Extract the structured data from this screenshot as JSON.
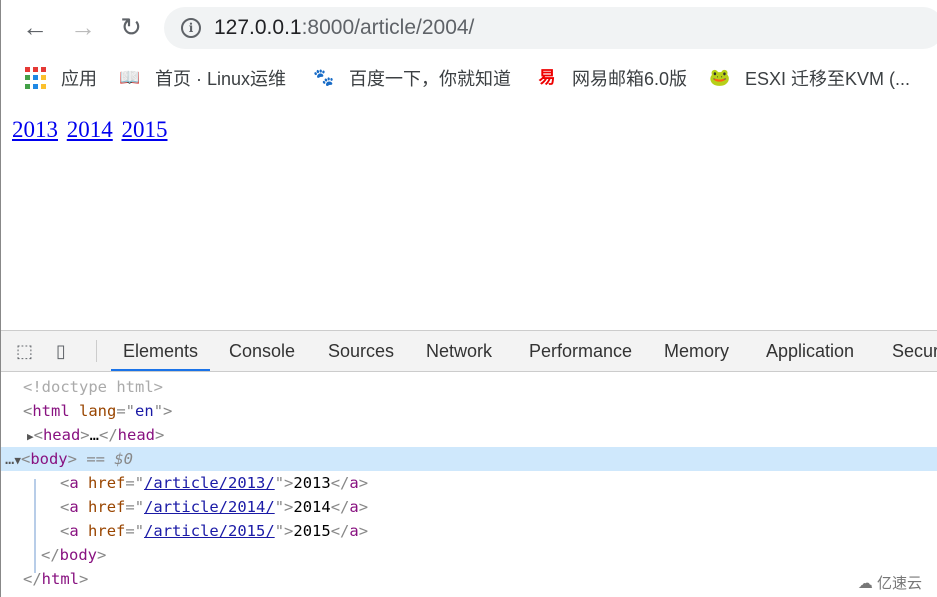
{
  "browser": {
    "url_host": "127.0.0.1",
    "url_rest": ":8000/article/2004/",
    "bookmarks": [
      {
        "label": "应用",
        "icon": "apps-grid-icon"
      },
      {
        "label": "首页 · Linux运维",
        "icon": "book-icon"
      },
      {
        "label": "百度一下，你就知道",
        "icon": "baidu-paw-icon"
      },
      {
        "label": "网易邮箱6.0版",
        "icon": "netease-icon"
      },
      {
        "label": "ESXI 迁移至KVM (...",
        "icon": "frog-icon"
      }
    ]
  },
  "page": {
    "links": [
      "2013",
      "2014",
      "2015"
    ]
  },
  "devtools": {
    "tabs": [
      "Elements",
      "Console",
      "Sources",
      "Network",
      "Performance",
      "Memory",
      "Application",
      "Securi"
    ],
    "active_tab": "Elements",
    "dom": {
      "doctype": "<!doctype html>",
      "html_open": "html",
      "lang_attr": "lang",
      "lang_val": "en",
      "head": "head",
      "body": "body",
      "selected_marker": "== $0",
      "anchors": [
        {
          "href": "/article/2013/",
          "text": "2013"
        },
        {
          "href": "/article/2014/",
          "text": "2014"
        },
        {
          "href": "/article/2015/",
          "text": "2015"
        }
      ]
    }
  },
  "watermark": "亿速云"
}
